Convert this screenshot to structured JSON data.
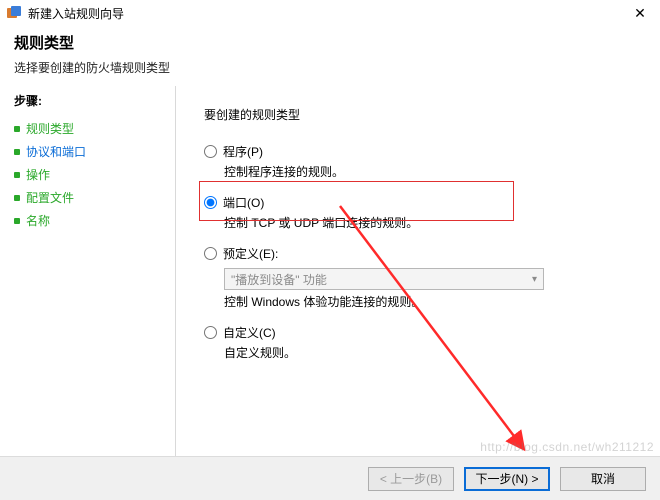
{
  "window": {
    "title": "新建入站规则向导",
    "close_glyph": "✕"
  },
  "header": {
    "title": "规则类型",
    "subtitle": "选择要创建的防火墙规则类型"
  },
  "sidebar": {
    "steps_title": "步骤:",
    "items": [
      {
        "label": "规则类型"
      },
      {
        "label": "协议和端口"
      },
      {
        "label": "操作"
      },
      {
        "label": "配置文件"
      },
      {
        "label": "名称"
      }
    ]
  },
  "content": {
    "prompt": "要创建的规则类型",
    "options": [
      {
        "label": "程序(P)",
        "desc": "控制程序连接的规则。"
      },
      {
        "label": "端口(O)",
        "desc": "控制 TCP 或 UDP 端口连接的规则。"
      },
      {
        "label": "预定义(E):",
        "combo": "\"播放到设备\" 功能",
        "desc": "控制 Windows 体验功能连接的规则。"
      },
      {
        "label": "自定义(C)",
        "desc": "自定义规则。"
      }
    ],
    "selected_index": 1
  },
  "footer": {
    "back": "< 上一步(B)",
    "next": "下一步(N) >",
    "cancel": "取消"
  },
  "watermark": "http://blog.csdn.net/wh211212"
}
